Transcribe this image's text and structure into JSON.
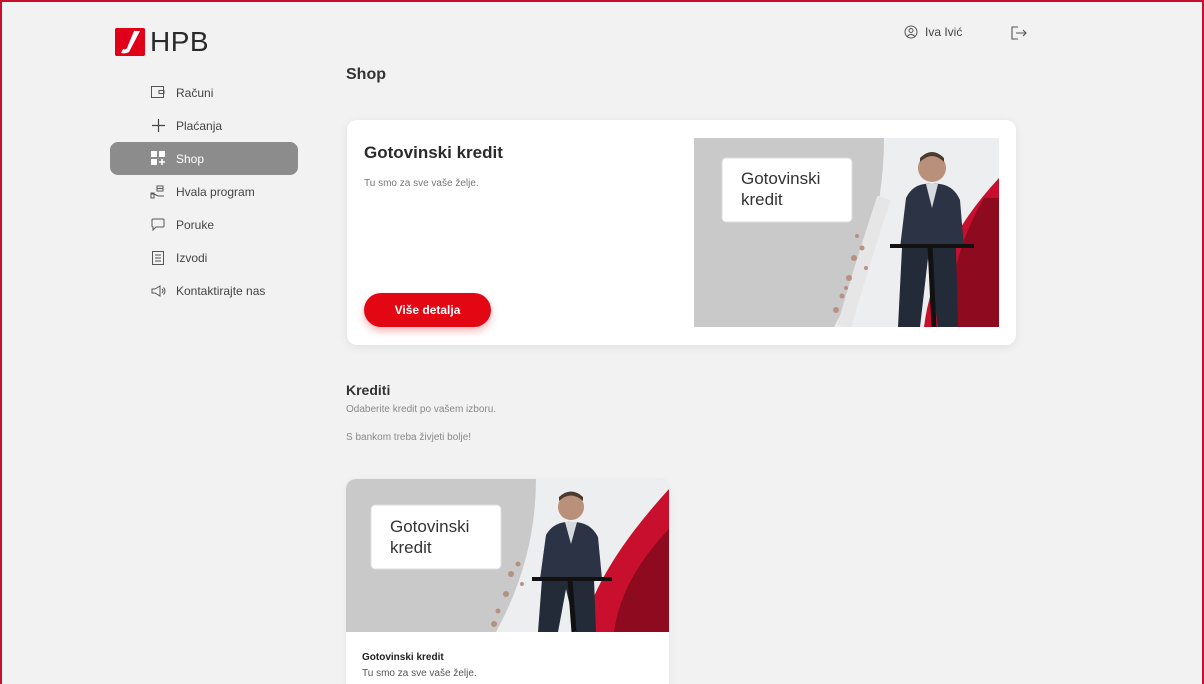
{
  "brand": {
    "name": "HPB",
    "accent": "#e30613",
    "active_nav_bg": "#8c8c8c"
  },
  "header": {
    "user_name": "Iva Ivić",
    "user_icon": "user-circle-icon",
    "logout_icon": "logout-icon"
  },
  "sidebar": {
    "items": [
      {
        "label": "Računi",
        "icon": "wallet-icon"
      },
      {
        "label": "Plaćanja",
        "icon": "plus-icon"
      },
      {
        "label": "Shop",
        "icon": "grid-plus-icon",
        "active": true
      },
      {
        "label": "Hvala program",
        "icon": "hand-gift-icon"
      },
      {
        "label": "Poruke",
        "icon": "chat-icon"
      },
      {
        "label": "Izvodi",
        "icon": "document-list-icon"
      },
      {
        "label": "Kontaktirajte nas",
        "icon": "megaphone-icon"
      }
    ]
  },
  "main": {
    "title": "Shop",
    "hero": {
      "title": "Gotovinski kredit",
      "subtitle": "Tu smo za sve vaše želje.",
      "button_label": "Više detalja",
      "image_text_line1": "Gotovinski",
      "image_text_line2": "kredit"
    },
    "section": {
      "title": "Krediti",
      "subtitle": "Odaberite kredit po vašem izboru.",
      "tagline": "S bankom treba živjeti bolje!"
    },
    "card": {
      "title": "Gotovinski kredit",
      "subtitle": "Tu smo za sve vaše želje.",
      "image_text_line1": "Gotovinski",
      "image_text_line2": "kredit"
    }
  }
}
